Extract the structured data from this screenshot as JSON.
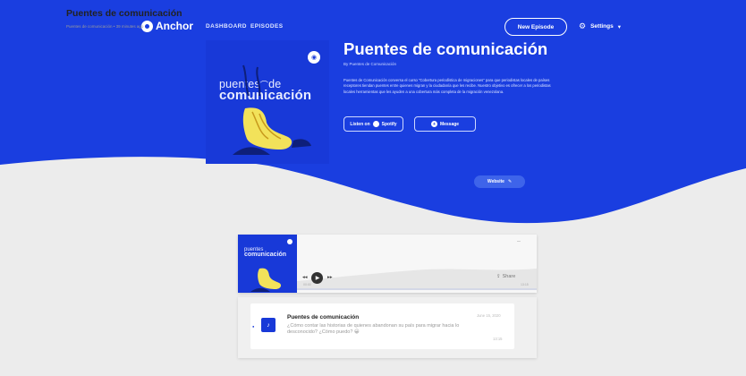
{
  "nav": {
    "logo": "Anchor",
    "links": [
      "DASHBOARD",
      "EPISODES"
    ],
    "new_episode": "New Episode",
    "settings": "Settings"
  },
  "podcast": {
    "cover_line1": "puentes",
    "cover_line1b": "de",
    "cover_line2": "comunicación",
    "title": "Puentes de comunicación",
    "byline": "By Puentes de Comunicación",
    "description": "Puentes de Comunicación conversa el curso \"Cobertura periodística de migraciones\" para que periodistas locales de países receptores tiendan puentes entre quienes migran y la ciudadanía que les recibe. Nuestro objetivo es ofrecer a los periodistas locales herramientas que les ayuden a una cobertura más completa de la migración venezolana.",
    "listen_on": "Listen on",
    "listen_service": "Spotify",
    "message": "Message",
    "website": "Website"
  },
  "player": {
    "title": "Puentes de comunicación",
    "meta": "Puentes de comunicación • 39 minutes ago",
    "share": "Share",
    "time_start": "00:00",
    "time_end": "13:15",
    "progress": 0.0
  },
  "episodes": [
    {
      "title": "Puentes de comunicación",
      "description": "¿Cómo contar las historias de quienes abandonan su país para migrar hacia lo desconocido? ¿Cómo puedo? 😀",
      "date": "June 15, 2020",
      "duration": "13:15"
    }
  ],
  "colors": {
    "brand_blue": "#1a3ee0",
    "background": "#ececec"
  }
}
